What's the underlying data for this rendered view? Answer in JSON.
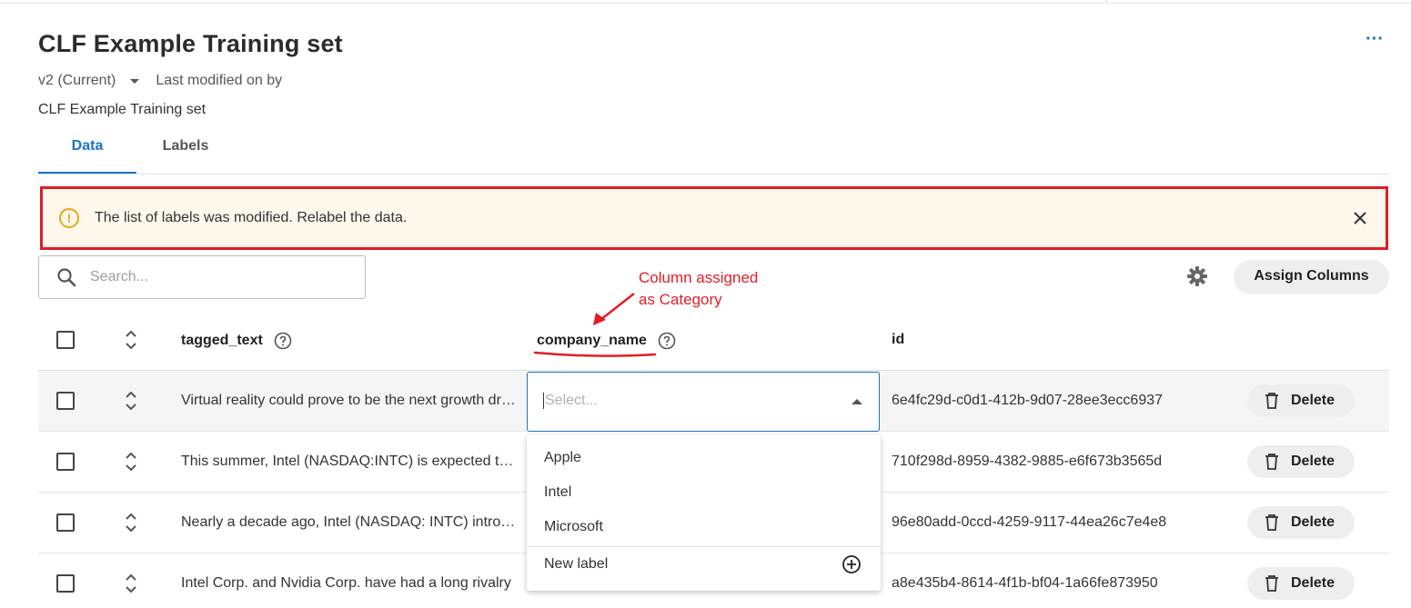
{
  "header": {
    "title": "CLF Example Training set",
    "more_label": "···",
    "version_label": "v2 (Current)",
    "last_modified": "Last modified on by",
    "subtitle": "CLF Example Training set"
  },
  "tabs": [
    {
      "label": "Data",
      "active": true
    },
    {
      "label": "Labels",
      "active": false
    }
  ],
  "alert": {
    "icon_char": "!",
    "message": "The list of labels was modified. Relabel the data."
  },
  "toolbar": {
    "search_placeholder": "Search...",
    "assign_label": "Assign Columns"
  },
  "annotation": {
    "line1": "Column assigned",
    "line2": "as Category",
    "color": "#e21d25"
  },
  "table": {
    "headers": {
      "tagged_text": "tagged_text",
      "company_name": "company_name",
      "id": "id"
    },
    "rows": [
      {
        "text": "Virtual reality could prove to be the next growth driver",
        "id": "6e4fc29d-c0d1-412b-9d07-28ee3ecc6937",
        "delete": "Delete"
      },
      {
        "text": "This summer, Intel (NASDAQ:INTC) is expected to launch",
        "id": "710f298d-8959-4382-9885-e6f673b3565d",
        "delete": "Delete"
      },
      {
        "text": "Nearly a decade ago, Intel (NASDAQ: INTC) introduced",
        "id": "96e80add-0ccd-4259-9117-44ea26c7e4e8",
        "delete": "Delete"
      },
      {
        "text": "Intel Corp. and Nvidia Corp. have had a long rivalry",
        "id": "a8e435b4-8614-4f1b-bf04-1a66fe873950",
        "delete": "Delete"
      }
    ]
  },
  "select": {
    "placeholder": "Select...",
    "options": [
      "Apple",
      "Intel",
      "Microsoft"
    ],
    "new_label": "New label"
  },
  "colors": {
    "accent": "#1a73c7",
    "alert_border": "#e21d25",
    "alert_bg": "#fdf7ec",
    "warning_icon": "#e6a817"
  }
}
